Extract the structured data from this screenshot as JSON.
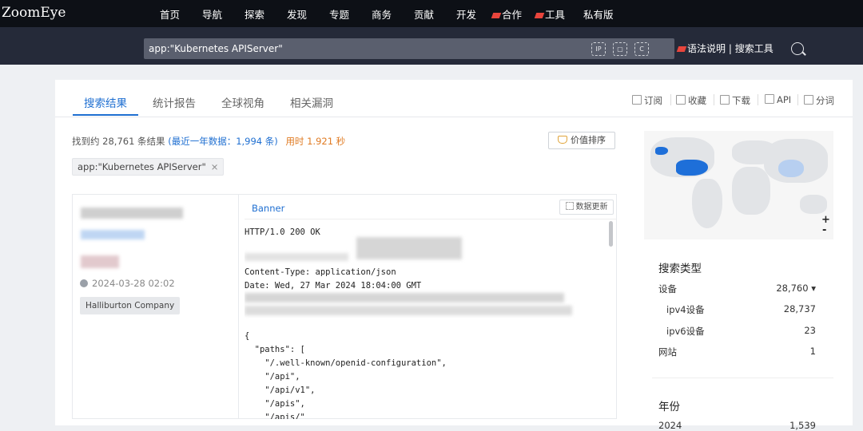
{
  "header": {
    "logo": "ZoomEye",
    "nav": [
      "首页",
      "导航",
      "探索",
      "发现",
      "专题",
      "商务",
      "贡献",
      "开发",
      "合作",
      "工具",
      "私有版"
    ]
  },
  "search": {
    "query": "app:\"Kubernetes APIServer\"",
    "icons": [
      "ip-icon",
      "device-icon",
      "c-segment-icon",
      "search-icon"
    ],
    "syntax_link": "语法说明",
    "separator": "|",
    "tools_link": "搜索工具"
  },
  "tabs": [
    "搜索结果",
    "统计报告",
    "全球视角",
    "相关漏洞"
  ],
  "toolbar": [
    "订阅",
    "收藏",
    "下载",
    "API",
    "分词"
  ],
  "summary": {
    "prefix": "找到约 28,761 条结果",
    "recent": "(最近一年数据：1,994 条)",
    "time": "用时 1.921 秒"
  },
  "sort_button": "价值排序",
  "filter_chip": "app:\"Kubernetes APIServer\"",
  "filter_chip_close": "×",
  "result": {
    "date": "2024-03-28 02:02",
    "company": "Halliburton Company",
    "banner_label": "Banner",
    "update_button": "数据更新",
    "lines": [
      "HTTP/1.0 200 OK",
      "",
      "Content-Type: application/json",
      "Date: Wed, 27 Mar 2024 18:04:00 GMT",
      "",
      "",
      "",
      "{",
      "  \"paths\": [",
      "    \"/.well-known/openid-configuration\",",
      "    \"/api\",",
      "    \"/api/v1\",",
      "    \"/apis\",",
      "    \"/apis/\""
    ]
  },
  "map": {
    "zoom_in": "+",
    "zoom_out": "-"
  },
  "facets": {
    "search_type": {
      "title": "搜索类型",
      "rows": [
        {
          "label": "设备",
          "value": "28,760 ▾"
        },
        {
          "label": "ipv4设备",
          "value": "28,737"
        },
        {
          "label": "ipv6设备",
          "value": "23"
        },
        {
          "label": "网站",
          "value": "1"
        }
      ]
    },
    "year": {
      "title": "年份",
      "rows": [
        {
          "label": "2024",
          "value": "1,539"
        }
      ]
    }
  }
}
